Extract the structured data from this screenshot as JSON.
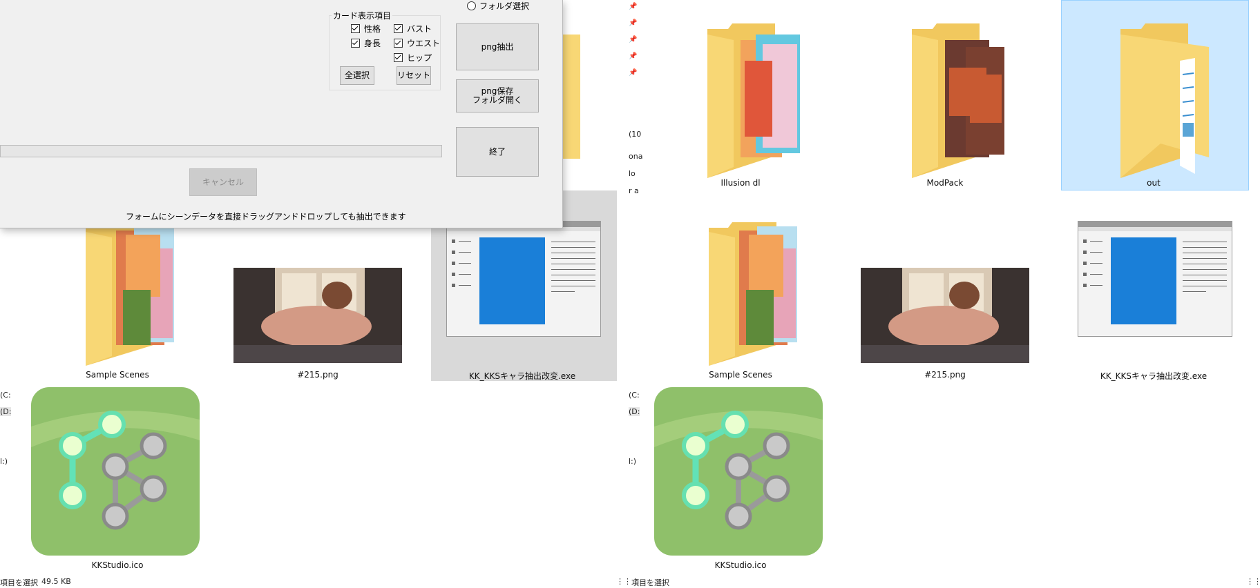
{
  "dialog": {
    "radio_folder": "フォルダ選択",
    "group_title": "カード表示項目",
    "checkboxes": [
      "性格",
      "身長",
      "バスト",
      "ウエスト",
      "ヒップ"
    ],
    "select_all": "全選択",
    "reset": "リセット",
    "png_extract": "png抽出",
    "png_save_open_line1": "png保存",
    "png_save_open_line2": "フォルダ開く",
    "exit": "終了",
    "cancel": "キャンセル",
    "hint": "フォームにシーンデータを直接ドラッグアンドドロップしても抽出できます"
  },
  "left_pane": {
    "items": [
      "Sample Scenes",
      "#215.png",
      "KK_KKSキャラ抽出改変.exe",
      "KKStudio.ico"
    ],
    "status_left": "項目を選択",
    "status_size": "49.5 KB",
    "side_labels": [
      "(C:",
      "(D:",
      "l:)"
    ]
  },
  "right_pane": {
    "items": [
      "Illusion dl",
      "ModPack",
      "out",
      "Sample Scenes",
      "#215.png",
      "KK_KKSキャラ抽出改変.exe",
      "KKStudio.ico"
    ],
    "status_left": "項目を選択",
    "side_labels": [
      "(10",
      "ona",
      "lo",
      "r a",
      "(C:",
      "(D:",
      "l:)"
    ]
  },
  "colors": {
    "selection": "#cce8ff",
    "selection_gray": "#d9d9d9",
    "folder": "#f8d775",
    "exe_blue": "#1a7fd8"
  }
}
